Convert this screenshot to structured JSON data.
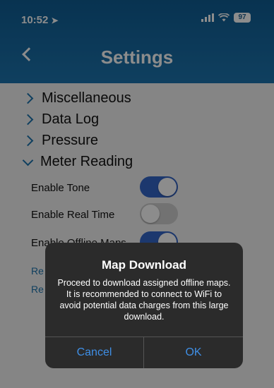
{
  "status_bar": {
    "time": "10:52",
    "battery": "97"
  },
  "header": {
    "title": "Settings"
  },
  "sections": [
    {
      "label": "Miscellaneous"
    },
    {
      "label": "Data Log"
    },
    {
      "label": "Pressure"
    },
    {
      "label": "Meter Reading"
    }
  ],
  "settings": [
    {
      "label": "Enable Tone",
      "enabled": true
    },
    {
      "label": "Enable Real Time",
      "enabled": false
    },
    {
      "label": "Enable Offline Maps",
      "enabled": true
    }
  ],
  "links": [
    {
      "label": "Re"
    },
    {
      "label": "Re"
    }
  ],
  "dialog": {
    "title": "Map Download",
    "message": "Proceed to download assigned offline maps. It is recommended to connect to WiFi to avoid potential data charges from this large download.",
    "cancel_label": "Cancel",
    "ok_label": "OK"
  }
}
